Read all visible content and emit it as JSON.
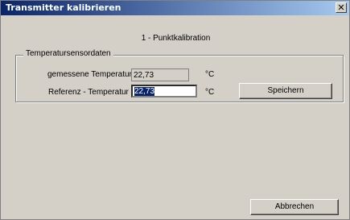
{
  "window": {
    "title": "Transmitter kalibrieren",
    "close_glyph": "✕"
  },
  "subtitle": "1 - Punktkalibration",
  "group": {
    "label": "Temperatursensordaten",
    "measured": {
      "label": "gemessene Temperatur",
      "value": "22,73",
      "unit": "°C"
    },
    "reference": {
      "label": "Referenz - Temperatur",
      "value": "22,73",
      "unit": "°C"
    }
  },
  "buttons": {
    "save": "Speichern",
    "cancel": "Abbrechen"
  },
  "colors": {
    "titlebar_start": "#0a246a",
    "titlebar_end": "#a6caf0",
    "face": "#d4d0c8"
  }
}
